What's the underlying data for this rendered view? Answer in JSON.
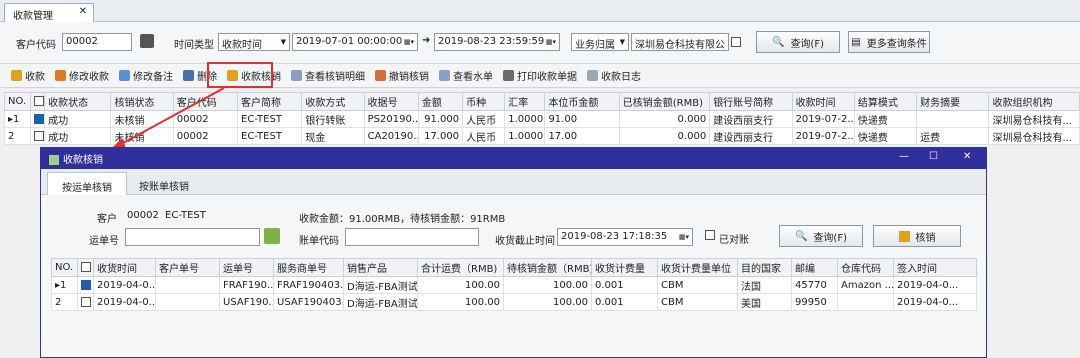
{
  "tab": {
    "label": "收款管理",
    "close": "✕"
  },
  "filter": {
    "cust_label": "客户代码",
    "cust_value": "00002",
    "time_type_label": "时间类型",
    "time_type_value": "收款时间",
    "date_from": "2019-07-01 00:00:00",
    "arrow": "➜",
    "date_to": "2019-08-23 23:59:59",
    "biz_value": "业务归属",
    "company_value": "深圳易仓科技有限公",
    "query": "查询(F)",
    "more_query": "更多查询条件"
  },
  "toolbar": [
    "收款",
    "修改收款",
    "修改备注",
    "删除",
    "收款核销",
    "查看核销明细",
    "撤销核销",
    "查看水单",
    "打印收款单据",
    "收款日志"
  ],
  "main_table": {
    "headers": [
      "NO.",
      "",
      "收款状态",
      "核销状态",
      "客户代码",
      "客户简称",
      "收款方式",
      "收据号",
      "金额",
      "币种",
      "汇率",
      "本位币金额",
      "已核销金额(RMB)",
      "银行账号简称",
      "收款时间",
      "结算模式",
      "财务摘要",
      "收款组织机构"
    ],
    "rows": [
      [
        "▸1",
        "",
        "成功",
        "未核销",
        "00002",
        "EC-TEST",
        "银行转账",
        "PS20190...",
        "91.000",
        "人民币",
        "1.0000...",
        "91.00",
        "0.000",
        "建设西丽支行",
        "2019-07-2...",
        "快递费",
        "",
        "深圳易仓科技有..."
      ],
      [
        "2",
        "",
        "成功",
        "未核销",
        "00002",
        "EC-TEST",
        "现金",
        "CA20190...",
        "17.000",
        "人民币",
        "1.0000...",
        "17.00",
        "0.000",
        "建设西丽支行",
        "2019-07-2...",
        "快递费",
        "运费",
        "深圳易仓科技有..."
      ]
    ]
  },
  "dialog": {
    "title": "收款核销",
    "min": "—",
    "max": "☐",
    "close": "✕",
    "tabs": [
      "按运单核销",
      "按账单核销"
    ],
    "cust_label": "客户",
    "cust_code": "00002",
    "cust_name": "EC-TEST",
    "amount_text": "收款金额：91.00RMB，待核销金额：91RMB",
    "waybill_label": "运单号",
    "bill_label": "账单代码",
    "deadline_label": "收货截止时间",
    "deadline_value": "2019-08-23 17:18:35",
    "reconciled_label": "已对账",
    "query": "查询(F)",
    "verify": "核销",
    "table": {
      "headers": [
        "NO.",
        "",
        "收货时间",
        "客户单号",
        "运单号",
        "服务商单号",
        "销售产品",
        "合计运费（RMB)",
        "待核销金额（RMB)",
        "收货计费量",
        "收货计费量单位",
        "目的国家",
        "邮编",
        "仓库代码",
        "签入时间"
      ],
      "rows": [
        [
          "▸1",
          "",
          "2019-04-0...",
          "",
          "FRAF190...",
          "FRAF190403...",
          "D海运-FBA测试",
          "100.00",
          "100.00",
          "0.001",
          "CBM",
          "法国",
          "45770",
          "Amazon ...",
          "2019-04-0..."
        ],
        [
          "2",
          "",
          "2019-04-0...",
          "",
          "USAF190...",
          "USAF190403...",
          "D海运-FBA测试",
          "100.00",
          "100.00",
          "0.001",
          "CBM",
          "美国",
          "99950",
          "",
          "2019-04-0..."
        ]
      ]
    }
  },
  "colors": {
    "title_bar": "#2f2f9e",
    "highlight": "#e0322c"
  }
}
